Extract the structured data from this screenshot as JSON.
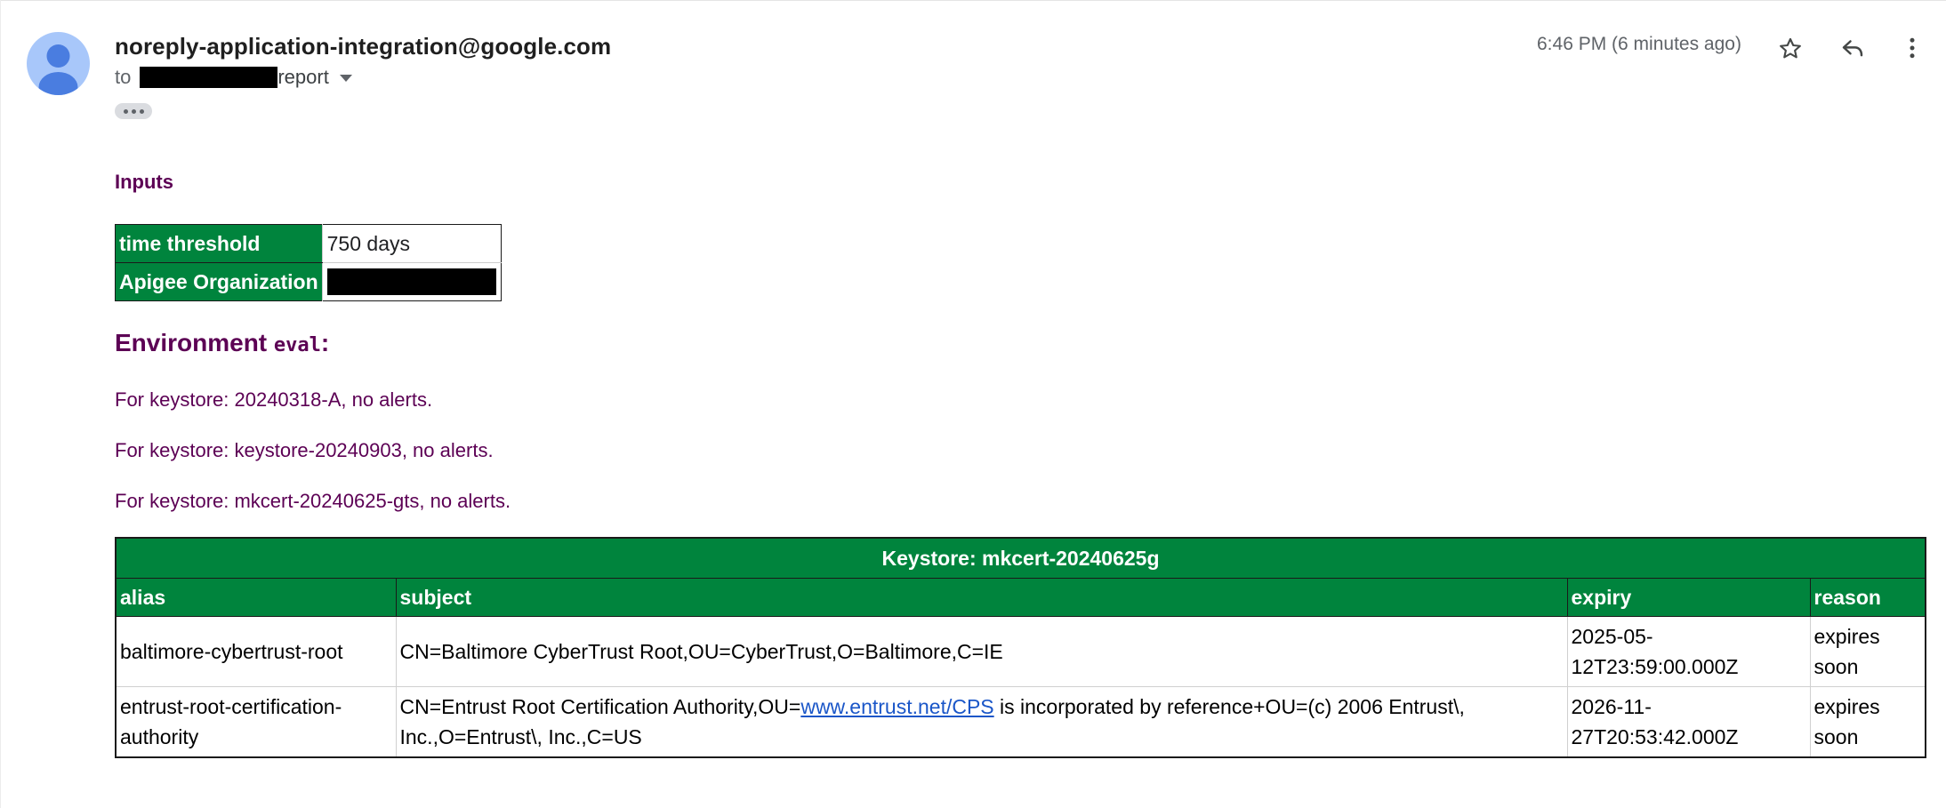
{
  "email": {
    "sender": "noreply-application-integration@google.com",
    "to_label": "to",
    "recipient_suffix": "report",
    "timestamp": "6:46 PM (6 minutes ago)"
  },
  "inputs": {
    "heading": "Inputs",
    "rows": [
      {
        "label": "time threshold",
        "value": "750 days"
      },
      {
        "label": "Apigee Organization",
        "value": ""
      }
    ]
  },
  "environment": {
    "heading_prefix": "Environment",
    "name": "eval",
    "heading_suffix": ":"
  },
  "keystore_lines": [
    "For keystore: 20240318-A, no alerts.",
    "For keystore: keystore-20240903, no alerts.",
    "For keystore: mkcert-20240625-gts, no alerts."
  ],
  "keystore_table": {
    "title": "Keystore: mkcert-20240625g",
    "columns": [
      "alias",
      "subject",
      "expiry",
      "reason"
    ],
    "rows": [
      {
        "alias": "baltimore-cybertrust-root",
        "subject": "CN=Baltimore CyberTrust Root,OU=CyberTrust,O=Baltimore,C=IE",
        "expiry": "2025-05-12T23:59:00.000Z",
        "reason": "expires soon"
      },
      {
        "alias": "entrust-root-certification-authority",
        "subject_before": "CN=Entrust Root Certification Authority,OU=",
        "subject_link": "www.entrust.net/CPS",
        "subject_after": " is incorporated by reference+OU=(c) 2006 Entrust\\, Inc.,O=Entrust\\, Inc.,C=US",
        "expiry": "2026-11-27T20:53:42.000Z",
        "reason": "expires soon"
      }
    ]
  },
  "icons": {
    "avatar": "person-avatar-icon",
    "star": "star-icon",
    "reply": "reply-icon",
    "more": "more-vert-icon"
  },
  "colors": {
    "header_green": "#00843d",
    "heading_purple": "#5c0054",
    "link_blue": "#1a56c8",
    "avatar_bg": "#a8c7fa",
    "avatar_fg": "#4a7de0"
  }
}
